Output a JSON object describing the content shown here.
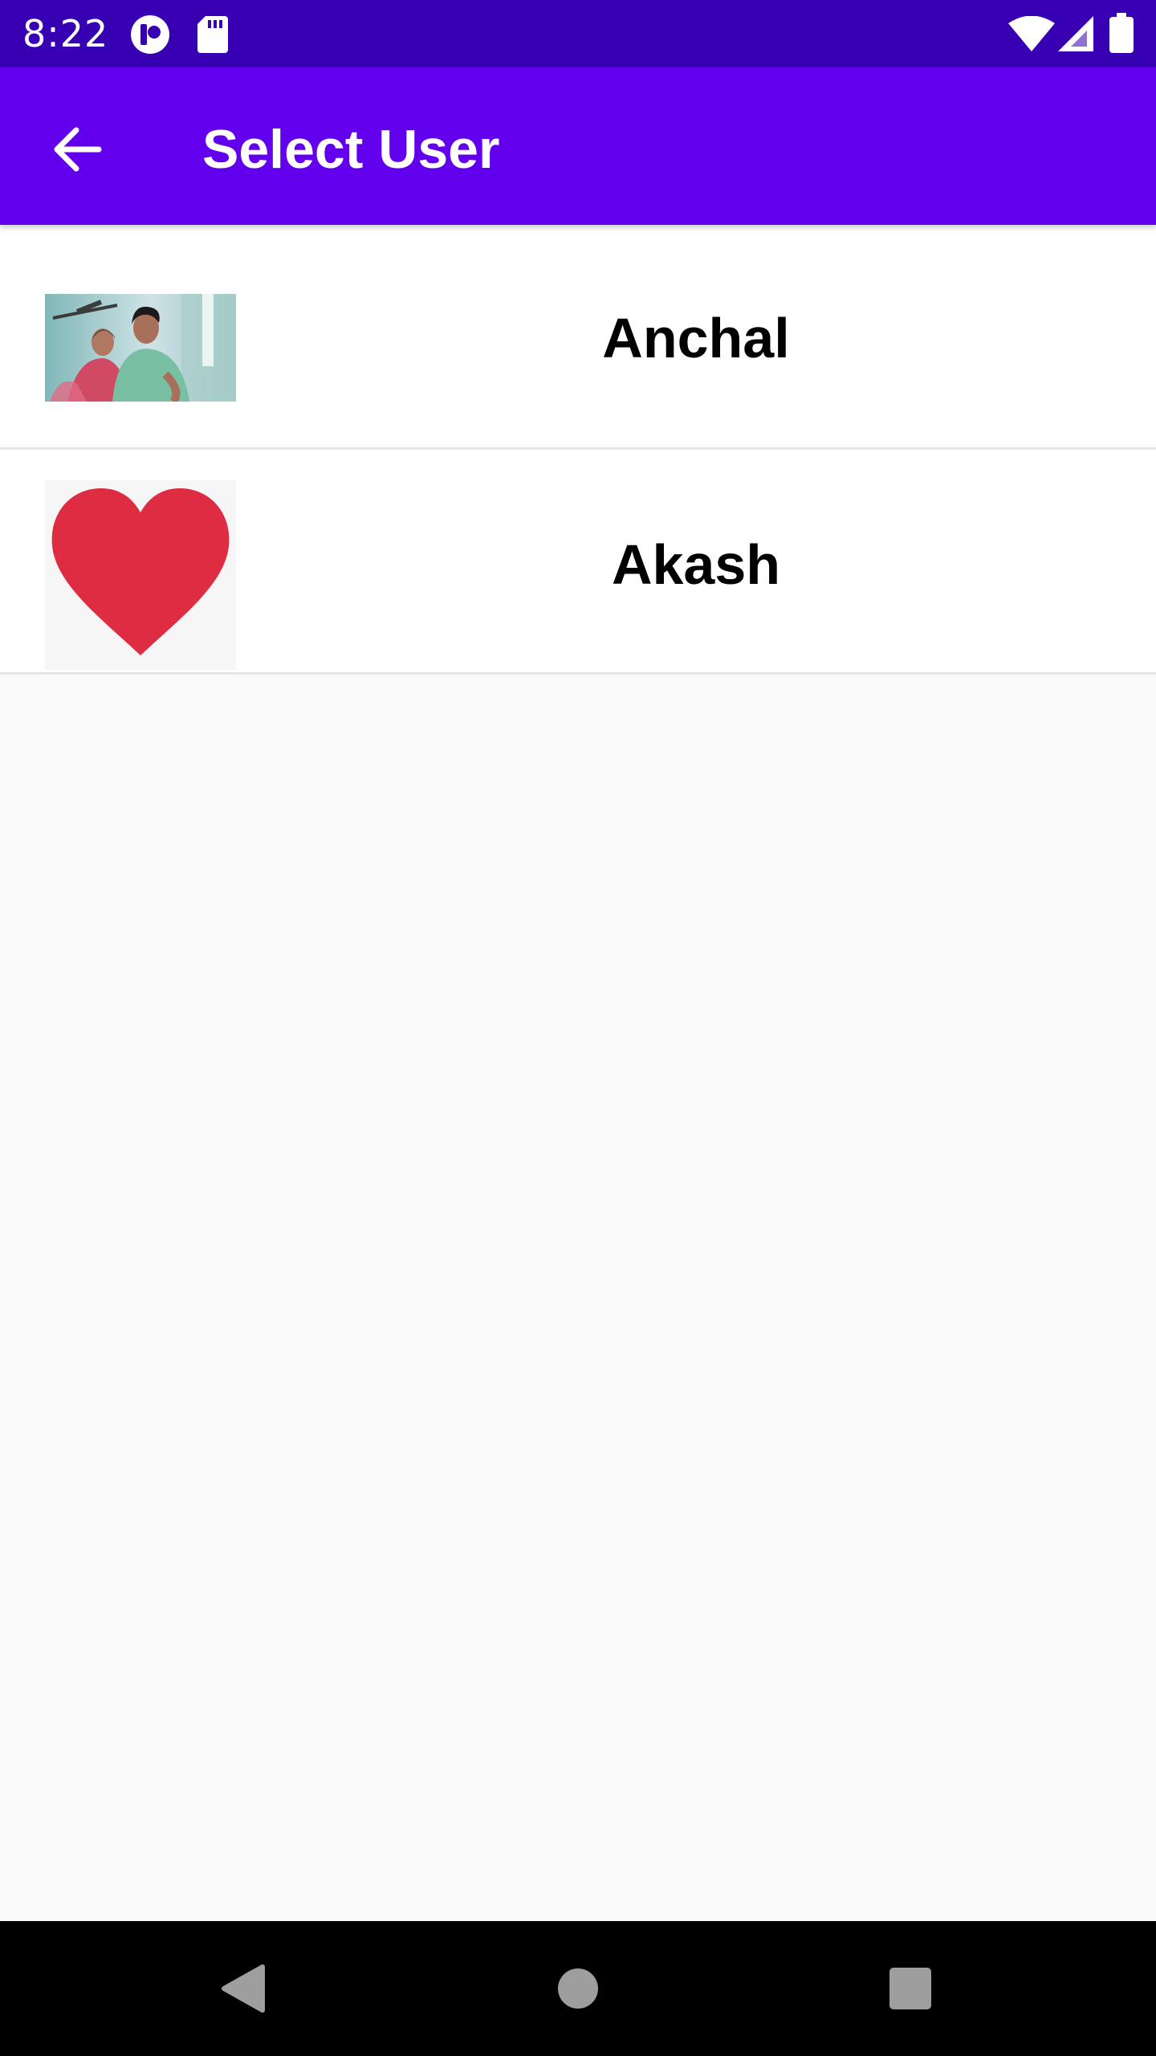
{
  "status_bar": {
    "time": "8:22",
    "icons": [
      "notification-app-icon",
      "sd-card-icon",
      "wifi-icon",
      "cellular-signal-icon",
      "battery-icon"
    ]
  },
  "app_bar": {
    "title": "Select User",
    "back_icon": "arrow-back-icon"
  },
  "users": [
    {
      "name": "Anchal",
      "avatar": "two-people-selfie-photo"
    },
    {
      "name": "Akash",
      "avatar": "red-heart-image"
    }
  ],
  "nav_bar": {
    "icons": [
      "back-triangle-icon",
      "home-circle-icon",
      "recents-square-icon"
    ]
  },
  "colors": {
    "status_bar": "#3700b3",
    "app_bar": "#6200ee",
    "heart": "#de2c42",
    "background": "#fafafa"
  }
}
